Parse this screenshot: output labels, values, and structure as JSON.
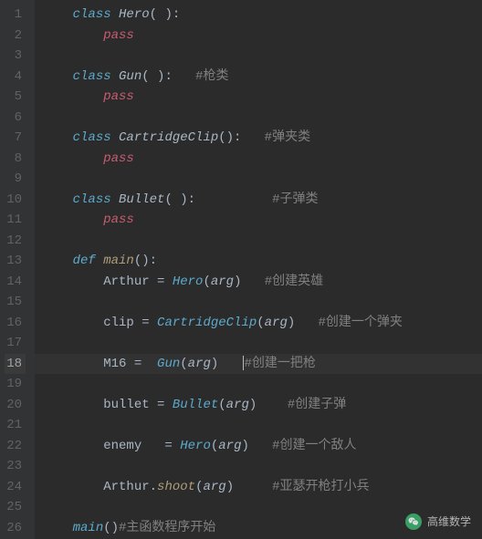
{
  "current_line": 18,
  "lines": [
    {
      "n": 1,
      "t": [
        {
          "c": "kw-class",
          "s": "class "
        },
        {
          "c": "ident-def",
          "s": "Hero"
        },
        {
          "c": "punct",
          "s": "( ):"
        }
      ]
    },
    {
      "n": 2,
      "t": [
        {
          "c": "",
          "s": "    "
        },
        {
          "c": "kw-pass",
          "s": "pass"
        }
      ]
    },
    {
      "n": 3,
      "t": []
    },
    {
      "n": 4,
      "t": [
        {
          "c": "kw-class",
          "s": "class "
        },
        {
          "c": "ident-def",
          "s": "Gun"
        },
        {
          "c": "punct",
          "s": "( ):   "
        },
        {
          "c": "comment",
          "s": "#枪类"
        }
      ]
    },
    {
      "n": 5,
      "t": [
        {
          "c": "",
          "s": "    "
        },
        {
          "c": "kw-pass",
          "s": "pass"
        }
      ]
    },
    {
      "n": 6,
      "t": []
    },
    {
      "n": 7,
      "t": [
        {
          "c": "kw-class",
          "s": "class "
        },
        {
          "c": "ident-def",
          "s": "CartridgeClip"
        },
        {
          "c": "punct",
          "s": "():   "
        },
        {
          "c": "comment",
          "s": "#弹夹类"
        }
      ]
    },
    {
      "n": 8,
      "t": [
        {
          "c": "",
          "s": "    "
        },
        {
          "c": "kw-pass",
          "s": "pass"
        }
      ]
    },
    {
      "n": 9,
      "t": []
    },
    {
      "n": 10,
      "t": [
        {
          "c": "kw-class",
          "s": "class "
        },
        {
          "c": "ident-def",
          "s": "Bullet"
        },
        {
          "c": "punct",
          "s": "( ):          "
        },
        {
          "c": "comment",
          "s": "#子弹类"
        }
      ]
    },
    {
      "n": 11,
      "t": [
        {
          "c": "",
          "s": "    "
        },
        {
          "c": "kw-pass",
          "s": "pass"
        }
      ]
    },
    {
      "n": 12,
      "t": []
    },
    {
      "n": 13,
      "t": [
        {
          "c": "kw-def",
          "s": "def "
        },
        {
          "c": "method",
          "s": "main"
        },
        {
          "c": "punct",
          "s": "():"
        }
      ]
    },
    {
      "n": 14,
      "t": [
        {
          "c": "",
          "s": "    "
        },
        {
          "c": "var",
          "s": "Arthur "
        },
        {
          "c": "punct",
          "s": "= "
        },
        {
          "c": "ident-call",
          "s": "Hero"
        },
        {
          "c": "punct",
          "s": "("
        },
        {
          "c": "arg",
          "s": "arg"
        },
        {
          "c": "punct",
          "s": ")   "
        },
        {
          "c": "comment",
          "s": "#创建英雄"
        }
      ]
    },
    {
      "n": 15,
      "t": []
    },
    {
      "n": 16,
      "t": [
        {
          "c": "",
          "s": "    "
        },
        {
          "c": "var",
          "s": "clip "
        },
        {
          "c": "punct",
          "s": "= "
        },
        {
          "c": "ident-call",
          "s": "CartridgeClip"
        },
        {
          "c": "punct",
          "s": "("
        },
        {
          "c": "arg",
          "s": "arg"
        },
        {
          "c": "punct",
          "s": ")   "
        },
        {
          "c": "comment",
          "s": "#创建一个弹夹"
        }
      ]
    },
    {
      "n": 17,
      "t": []
    },
    {
      "n": 18,
      "t": [
        {
          "c": "",
          "s": "    "
        },
        {
          "c": "var",
          "s": "M16 "
        },
        {
          "c": "punct",
          "s": "=  "
        },
        {
          "c": "ident-call",
          "s": "Gun"
        },
        {
          "c": "punct",
          "s": "("
        },
        {
          "c": "arg",
          "s": "arg"
        },
        {
          "c": "punct",
          "s": ")   "
        },
        {
          "cursor": true
        },
        {
          "c": "comment",
          "s": "#创建一把枪"
        }
      ]
    },
    {
      "n": 19,
      "t": []
    },
    {
      "n": 20,
      "t": [
        {
          "c": "",
          "s": "    "
        },
        {
          "c": "var",
          "s": "bullet "
        },
        {
          "c": "punct",
          "s": "= "
        },
        {
          "c": "ident-call",
          "s": "Bullet"
        },
        {
          "c": "punct",
          "s": "("
        },
        {
          "c": "arg",
          "s": "arg"
        },
        {
          "c": "punct",
          "s": ")    "
        },
        {
          "c": "comment",
          "s": "#创建子弹"
        }
      ]
    },
    {
      "n": 21,
      "t": []
    },
    {
      "n": 22,
      "t": [
        {
          "c": "",
          "s": "    "
        },
        {
          "c": "var",
          "s": "enemy  "
        },
        {
          "c": "punct",
          "s": " = "
        },
        {
          "c": "ident-call",
          "s": "Hero"
        },
        {
          "c": "punct",
          "s": "("
        },
        {
          "c": "arg",
          "s": "arg"
        },
        {
          "c": "punct",
          "s": ")   "
        },
        {
          "c": "comment",
          "s": "#创建一个敌人"
        }
      ]
    },
    {
      "n": 23,
      "t": []
    },
    {
      "n": 24,
      "t": [
        {
          "c": "",
          "s": "    "
        },
        {
          "c": "var",
          "s": "Arthur"
        },
        {
          "c": "punct",
          "s": "."
        },
        {
          "c": "method",
          "s": "shoot"
        },
        {
          "c": "punct",
          "s": "("
        },
        {
          "c": "arg",
          "s": "arg"
        },
        {
          "c": "punct",
          "s": ")     "
        },
        {
          "c": "comment",
          "s": "#亚瑟开枪打小兵"
        }
      ]
    },
    {
      "n": 25,
      "t": []
    },
    {
      "n": 26,
      "t": [
        {
          "c": "ident-call",
          "s": "main"
        },
        {
          "c": "punct",
          "s": "()"
        },
        {
          "c": "comment",
          "s": "#主函数程序开始"
        }
      ]
    }
  ],
  "indent_prefix": "    ",
  "watermark": {
    "text": "高维数学"
  }
}
